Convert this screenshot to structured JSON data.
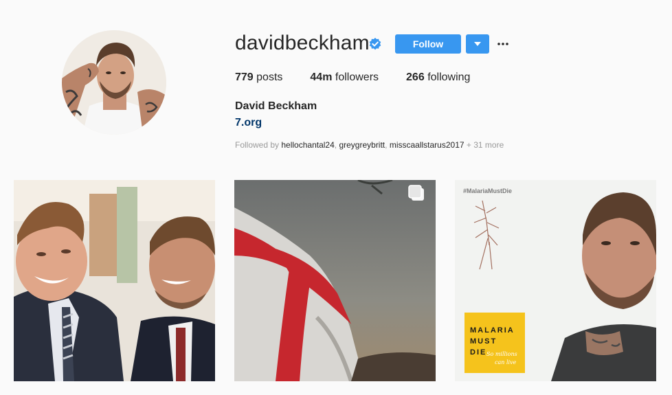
{
  "profile": {
    "username": "davidbeckham",
    "follow_label": "Follow",
    "posts_count": "779",
    "posts_label": "posts",
    "followers_count": "44m",
    "followers_label": "followers",
    "following_count": "266",
    "following_label": "following",
    "full_name": "David Beckham",
    "website": "7.org",
    "followed_by_prefix": "Followed by",
    "followed_by_users": [
      "hellochantal24",
      "greygreybritt",
      "misscaallstarus2017"
    ],
    "followed_by_more": "+ 31 more"
  },
  "posts": [
    {
      "type": "photo",
      "description_icon": "photo"
    },
    {
      "type": "carousel",
      "description_icon": "carousel-icon"
    },
    {
      "type": "photo",
      "hashtag": "#MalariaMustDie",
      "poster_lines": [
        "MALARIA",
        "MUST",
        "DIE"
      ],
      "poster_script": "So millions can live"
    }
  ],
  "colors": {
    "accent": "#3897f0",
    "link": "#003569",
    "poster_yellow": "#f5c31c"
  }
}
